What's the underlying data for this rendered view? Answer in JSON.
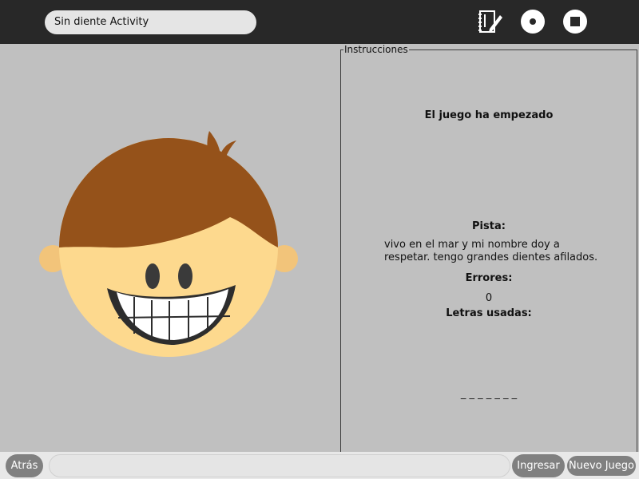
{
  "toolbar": {
    "activity_title": "Sin diente Activity",
    "icons": [
      "journal-icon",
      "share-icon",
      "stop-icon"
    ]
  },
  "panel": {
    "legend": "Instrucciones",
    "status": "El juego ha empezado",
    "hint_label": "Pista:",
    "hint_text": "vivo en el mar y mi nombre doy a respetar. tengo grandes dientes afilados.",
    "errors_label": "Errores:",
    "errors_value": "0",
    "used_letters_label": "Letras usadas:",
    "word_blanks": "_ _ _ _ _ _ _"
  },
  "bottom": {
    "back_label": "Atrás",
    "entry_value": "",
    "enter_label": "Ingresar",
    "new_game_label": "Nuevo Juego"
  },
  "colors": {
    "toolbar": "#282828",
    "background": "#c0c0c0",
    "hair": "#95521a",
    "skin": "#fdd98e",
    "ear": "#f2c47a",
    "button": "#808080"
  }
}
